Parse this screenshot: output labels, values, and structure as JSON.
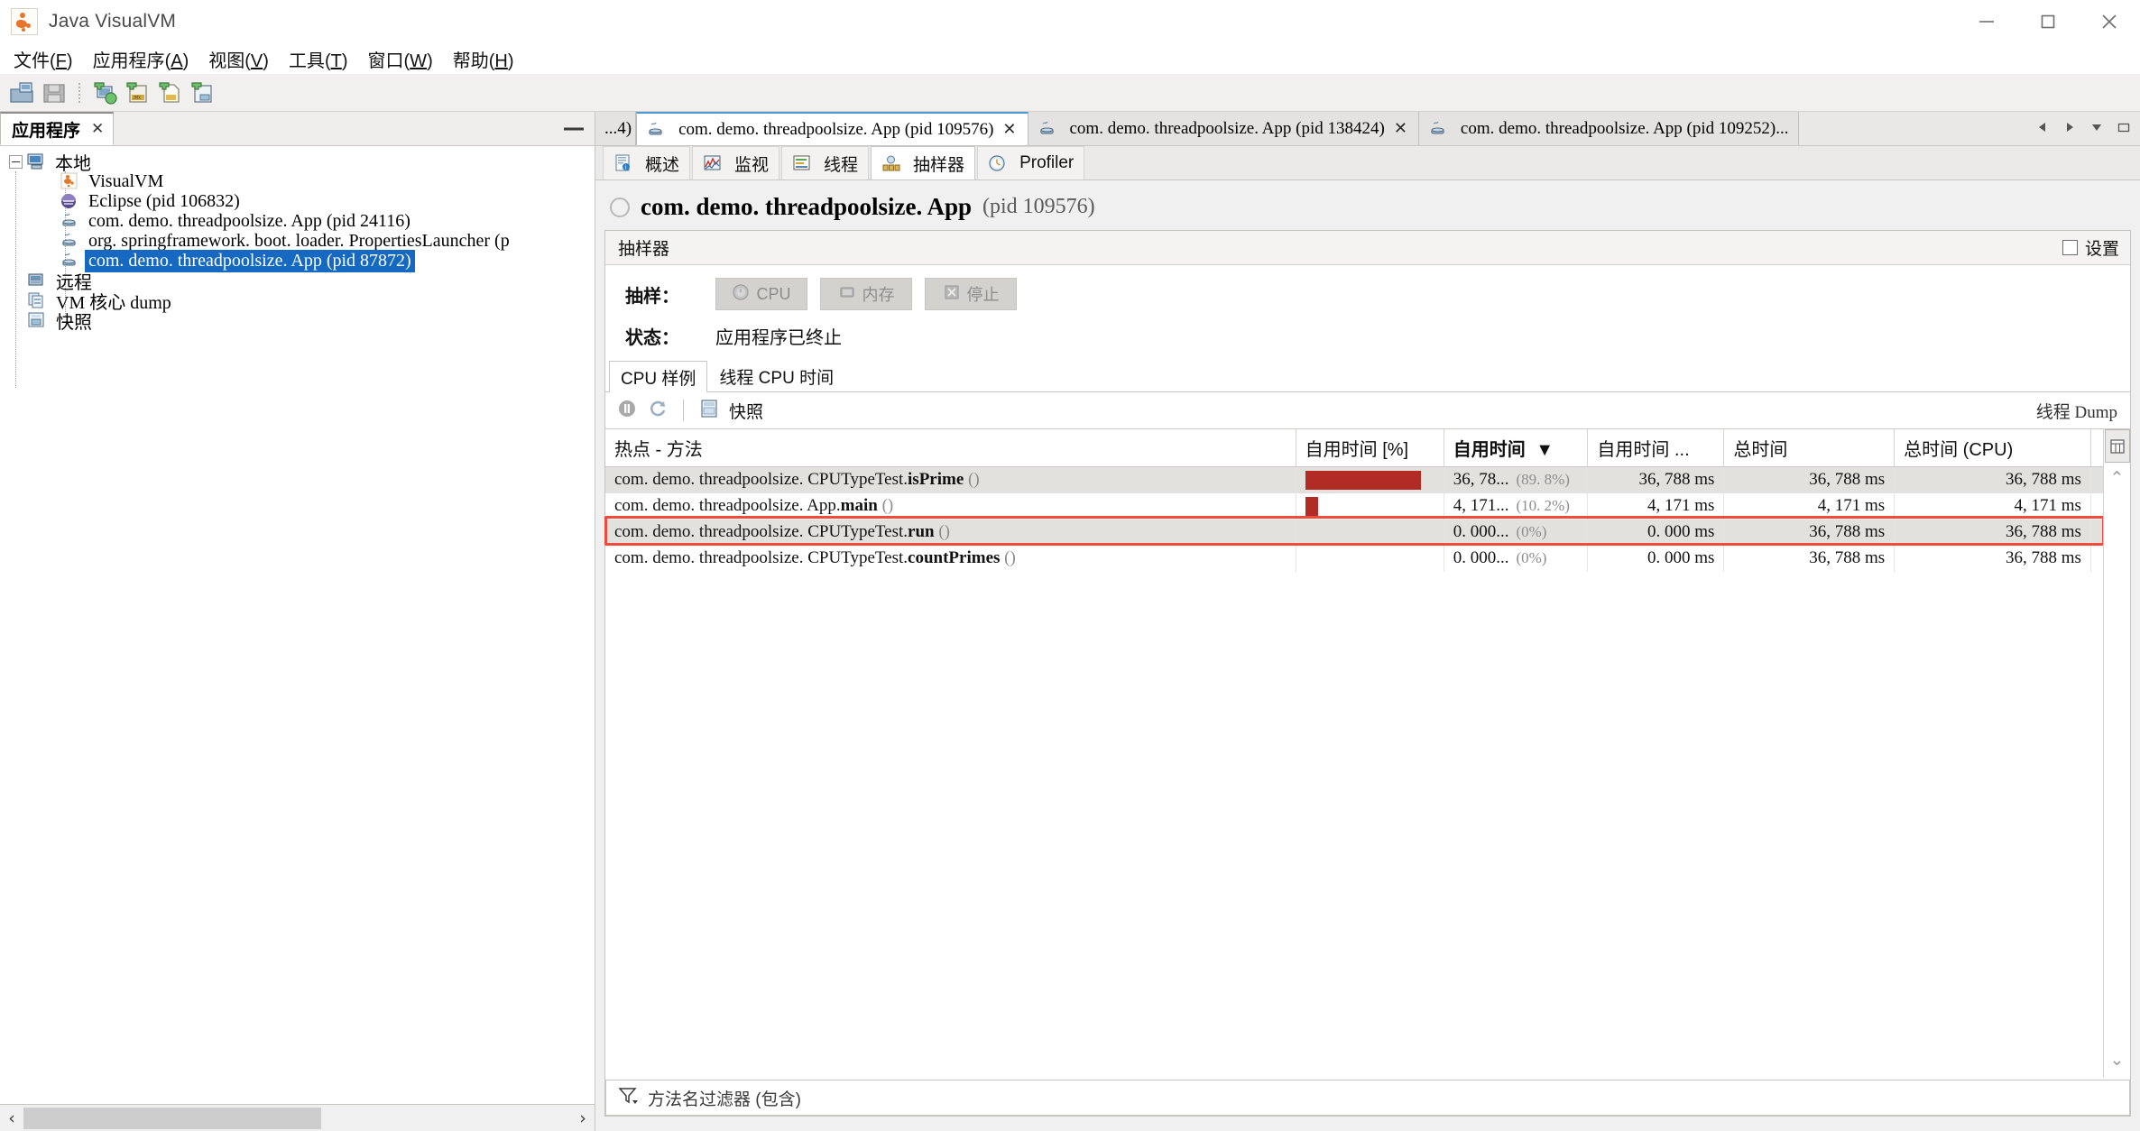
{
  "window": {
    "title": "Java VisualVM",
    "icon": "visualvm-icon",
    "controls": {
      "minimize": "minimize-icon",
      "maximize": "maximize-icon",
      "close": "close-icon"
    }
  },
  "menubar": [
    {
      "label": "文件",
      "mnemonic": "F"
    },
    {
      "label": "应用程序",
      "mnemonic": "A"
    },
    {
      "label": "视图",
      "mnemonic": "V"
    },
    {
      "label": "工具",
      "mnemonic": "T"
    },
    {
      "label": "窗口",
      "mnemonic": "W"
    },
    {
      "label": "帮助",
      "mnemonic": "H"
    }
  ],
  "toolbar": {
    "buttons": [
      {
        "name": "load-snapshot-icon"
      },
      {
        "name": "save-snapshot-icon"
      },
      {
        "name": "add-remote-host-icon"
      },
      {
        "name": "add-jmx-connection-icon"
      },
      {
        "name": "add-vm-coredump-icon"
      },
      {
        "name": "add-snapshot-icon"
      }
    ]
  },
  "sidebar": {
    "tab_label": "应用程序",
    "close_label": "✕",
    "minimize_label": "minimize-icon",
    "tree": [
      {
        "level": 0,
        "label": "本地",
        "icon": "computer-icon",
        "expanded": true,
        "selected": false
      },
      {
        "level": 1,
        "label": "VisualVM",
        "icon": "visualvm-icon",
        "selected": false
      },
      {
        "level": 1,
        "label": "Eclipse (pid 106832)",
        "icon": "eclipse-icon",
        "selected": false
      },
      {
        "level": 1,
        "label": "com. demo. threadpoolsize. App (pid 24116)",
        "icon": "java-icon",
        "selected": false
      },
      {
        "level": 1,
        "label": "org. springframework. boot. loader. PropertiesLauncher (p",
        "icon": "java-icon",
        "selected": false
      },
      {
        "level": 1,
        "label": "com. demo. threadpoolsize. App (pid 87872)",
        "icon": "java-icon",
        "selected": true
      },
      {
        "level": 0,
        "label": "远程",
        "icon": "remote-icon",
        "selected": false
      },
      {
        "level": 0,
        "label": "VM 核心 dump",
        "icon": "coredump-icon",
        "selected": false
      },
      {
        "level": 0,
        "label": "快照",
        "icon": "snapshot-icon",
        "selected": false
      }
    ],
    "hscroll": {
      "left_arrow": "‹",
      "right_arrow": "›"
    }
  },
  "app_tabs": [
    {
      "label": "...4)",
      "icon": "",
      "active": false,
      "closable": false,
      "clipped": true
    },
    {
      "label": "com. demo. threadpoolsize. App (pid 109576)",
      "icon": "java-icon",
      "active": true,
      "closable": true
    },
    {
      "label": "com. demo. threadpoolsize. App (pid 138424)",
      "icon": "java-icon",
      "active": false,
      "closable": true
    },
    {
      "label": "com. demo. threadpoolsize. App (pid 109252)...",
      "icon": "java-icon",
      "active": false,
      "closable": false
    }
  ],
  "tab_nav": {
    "prev": "scroll-left-icon",
    "next": "scroll-right-icon",
    "list": "tab-list-icon",
    "maximize": "maximize-tab-icon"
  },
  "view_tabs": [
    {
      "label": "概述",
      "icon": "overview-icon",
      "active": false
    },
    {
      "label": "监视",
      "icon": "monitor-icon",
      "active": false
    },
    {
      "label": "线程",
      "icon": "threads-icon",
      "active": false
    },
    {
      "label": "抽样器",
      "icon": "sampler-icon",
      "active": true
    },
    {
      "label": "Profiler",
      "icon": "profiler-icon",
      "active": false
    }
  ],
  "page": {
    "title_main": "com. demo. threadpoolsize. App",
    "title_pid": "(pid 109576)",
    "status_icon": "circle-icon"
  },
  "sampler": {
    "header": "抽样器",
    "settings_label": "设置",
    "settings_checked": false,
    "sample_label": "抽样：",
    "buttons": [
      {
        "label": "CPU",
        "icon": "cpu-icon",
        "enabled": false
      },
      {
        "label": "内存",
        "icon": "memory-icon",
        "enabled": false
      },
      {
        "label": "停止",
        "icon": "stop-icon",
        "enabled": false
      }
    ],
    "status_label": "状态：",
    "status_value": "应用程序已终止"
  },
  "inner_tabs": [
    {
      "label": "CPU 样例",
      "active": true
    },
    {
      "label": "线程 CPU 时间",
      "active": false
    }
  ],
  "mini_toolbar": {
    "pause_icon": "pause-icon",
    "refresh_icon": "refresh-icon",
    "snapshot_icon": "snapshot-icon",
    "snapshot_label": "快照",
    "thread_dump_label": "线程 Dump"
  },
  "table": {
    "columns": [
      {
        "label": "热点 - 方法",
        "sorted": false
      },
      {
        "label": "自用时间 [%]",
        "sorted": false
      },
      {
        "label": "自用时间",
        "sorted": true,
        "sort_dir": "desc"
      },
      {
        "label": "自用时间 ...",
        "sorted": false
      },
      {
        "label": "总时间",
        "sorted": false
      },
      {
        "label": "总时间 (CPU)",
        "sorted": false
      }
    ],
    "column_chooser_icon": "column-chooser-icon",
    "rows": [
      {
        "method_prefix": "com. demo. threadpoolsize. CPUTypeTest.",
        "method_name": "isPrime",
        "method_suffix": "()",
        "bar_pct": 89.8,
        "self_time": "36, 78...",
        "self_time_pct": "(89. 8%)",
        "self_time_cpu": "36, 788 ms",
        "total_time": "36, 788 ms",
        "total_time_cpu": "36, 788 ms",
        "alt": true,
        "highlighted": false
      },
      {
        "method_prefix": "com. demo. threadpoolsize. App.",
        "method_name": "main",
        "method_suffix": "()",
        "bar_pct": 10.2,
        "self_time": "4, 171...",
        "self_time_pct": "(10. 2%)",
        "self_time_cpu": "4, 171 ms",
        "total_time": "4, 171 ms",
        "total_time_cpu": "4, 171 ms",
        "alt": false,
        "highlighted": false
      },
      {
        "method_prefix": "com. demo. threadpoolsize. CPUTypeTest.",
        "method_name": "run",
        "method_suffix": "()",
        "bar_pct": 0,
        "self_time": "0. 000...",
        "self_time_pct": "(0%)",
        "self_time_cpu": "0. 000 ms",
        "total_time": "36, 788 ms",
        "total_time_cpu": "36, 788 ms",
        "alt": true,
        "highlighted": true
      },
      {
        "method_prefix": "com. demo. threadpoolsize. CPUTypeTest.",
        "method_name": "countPrimes",
        "method_suffix": "()",
        "bar_pct": 0,
        "self_time": "0. 000...",
        "self_time_pct": "(0%)",
        "self_time_cpu": "0. 000 ms",
        "total_time": "36, 788 ms",
        "total_time_cpu": "36, 788 ms",
        "alt": false,
        "highlighted": false
      }
    ],
    "scroll_up_icon": "scroll-up-icon",
    "scroll_down_icon": "scroll-down-icon"
  },
  "filter": {
    "icon": "filter-icon",
    "placeholder": "方法名过滤器 (包含)"
  },
  "colors": {
    "bar_red": "#b22b24",
    "highlight_red": "#f1493c",
    "selection_blue": "#1669c1",
    "active_tab_blue": "#4e9ad8"
  }
}
